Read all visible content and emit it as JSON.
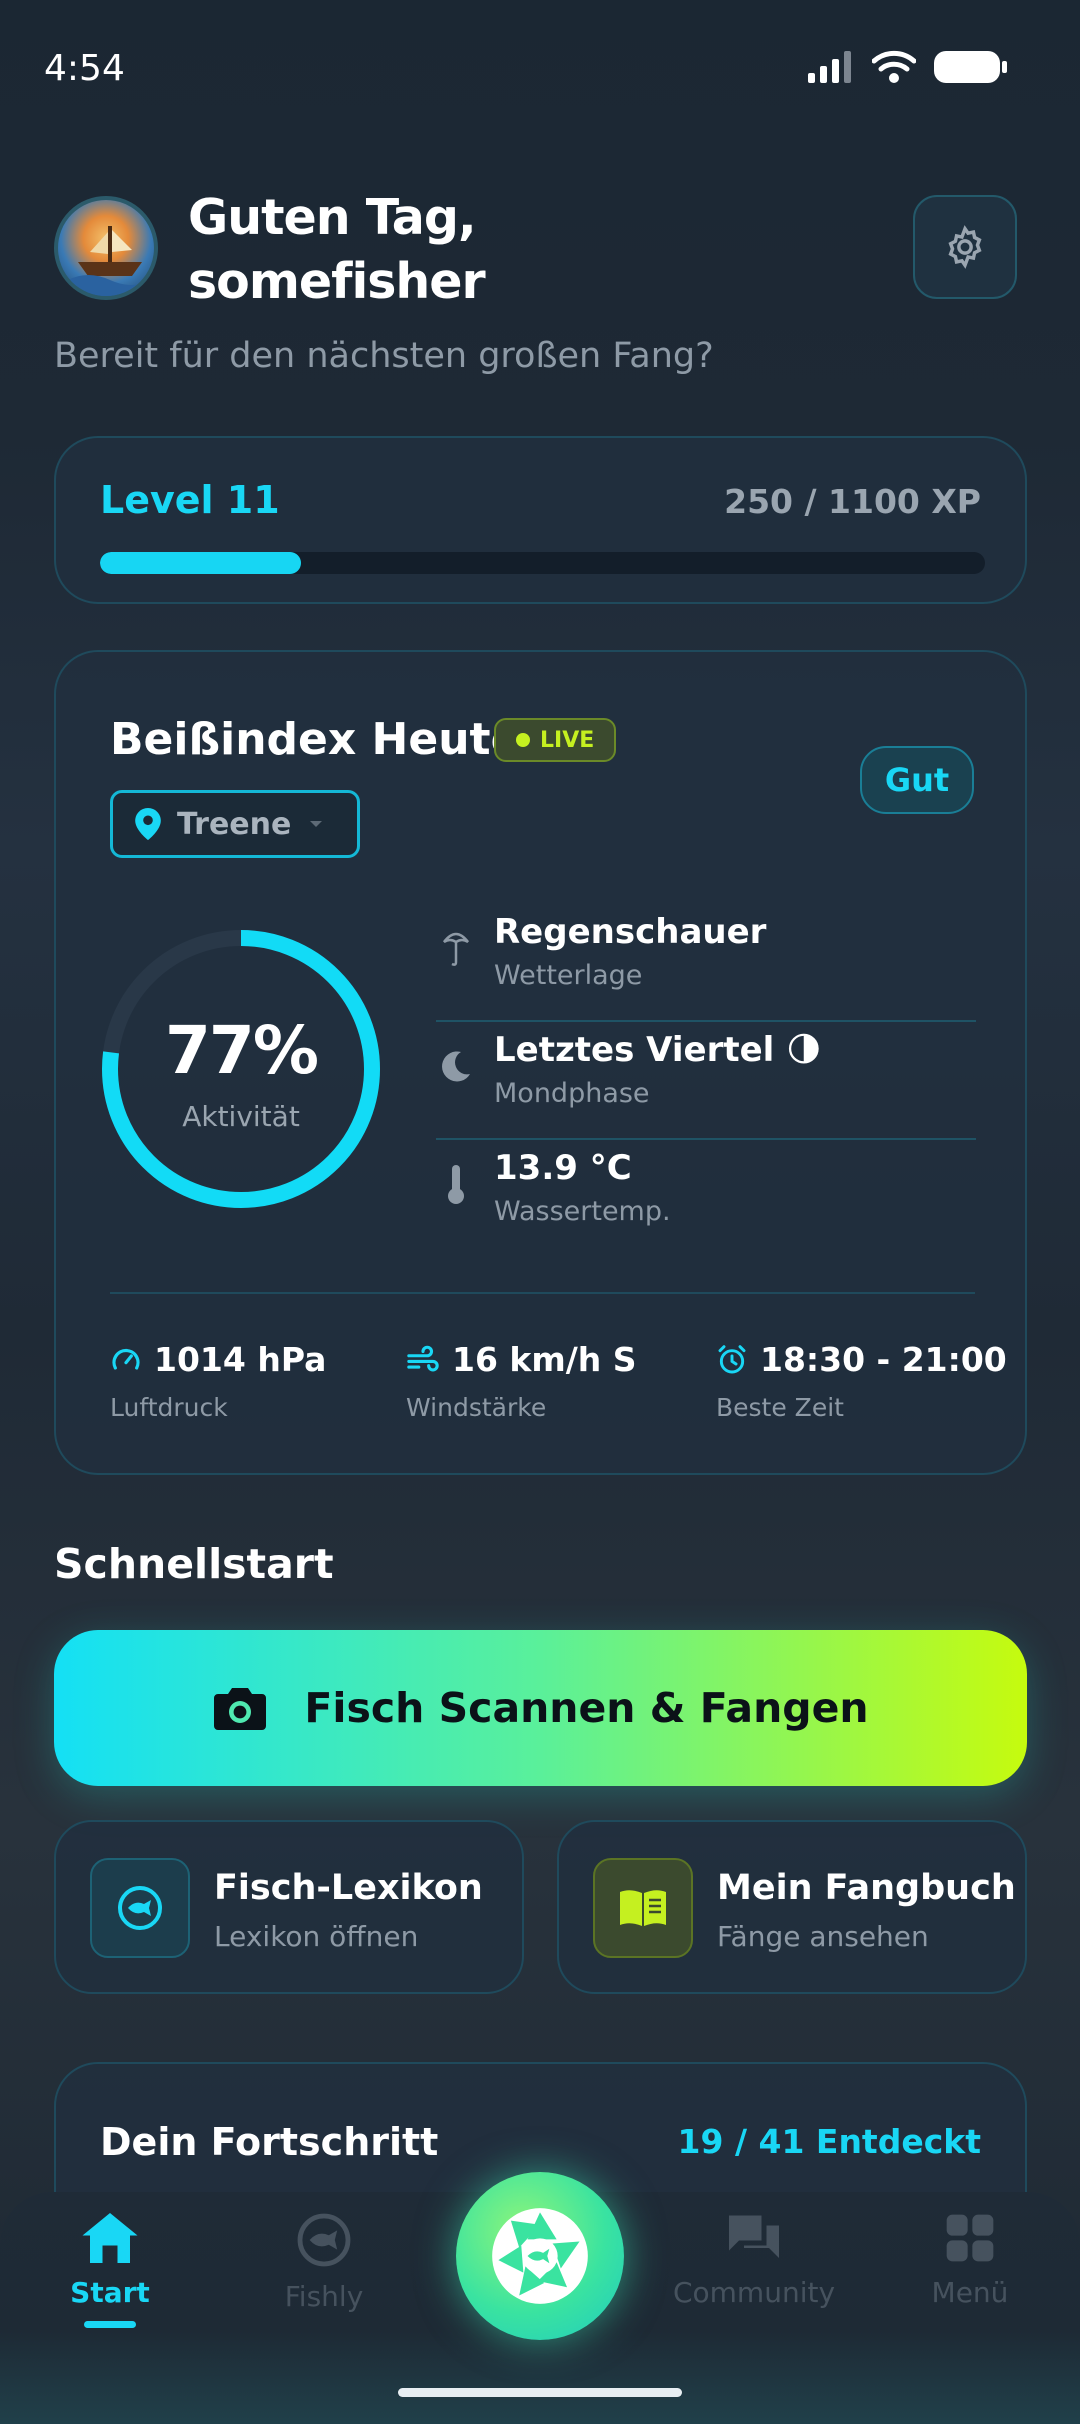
{
  "status_bar": {
    "time": "4:54"
  },
  "header": {
    "greeting": "Guten Tag, somefisher",
    "subtitle": "Bereit für den nächsten großen Fang?"
  },
  "level": {
    "label": "Level 11",
    "xp_text": "250 / 1100 XP",
    "progress_fraction": 0.227
  },
  "bite_index": {
    "title": "Beißindex Heute",
    "live_label": "LIVE",
    "rating": "Gut",
    "location": "Treene",
    "activity_value": "77%",
    "activity_fraction": 0.77,
    "activity_label": "Aktivität",
    "conditions": [
      {
        "icon": "umbrella-icon",
        "value": "Regenschauer",
        "label": "Wetterlage"
      },
      {
        "icon": "moon-icon",
        "value": "Letztes Viertel 🌗",
        "label": "Mondphase"
      },
      {
        "icon": "thermometer-icon",
        "value": "13.9 °C",
        "label": "Wassertemp."
      }
    ],
    "stats": [
      {
        "icon": "gauge-icon",
        "value": "1014 hPa",
        "label": "Luftdruck"
      },
      {
        "icon": "wind-icon",
        "value": "16 km/h S",
        "label": "Windstärke"
      },
      {
        "icon": "alarm-icon",
        "value": "18:30 - 21:00",
        "label": "Beste Zeit"
      }
    ]
  },
  "quickstart": {
    "title": "Schnellstart",
    "scan_label": "Fisch Scannen & Fangen",
    "tiles": [
      {
        "title": "Fisch-Lexikon",
        "subtitle": "Lexikon öffnen"
      },
      {
        "title": "Mein Fangbuch",
        "subtitle": "Fänge ansehen"
      }
    ]
  },
  "progress": {
    "title": "Dein Fortschritt",
    "count": "19 / 41 Entdeckt"
  },
  "nav": {
    "items": [
      {
        "label": "Start",
        "active": true
      },
      {
        "label": "Fishly",
        "active": false
      },
      {
        "label": "Community",
        "active": false
      },
      {
        "label": "Menü",
        "active": false
      }
    ]
  },
  "colors": {
    "accent": "#19d7f5",
    "lime": "#c5f020",
    "card": "#212f3e"
  }
}
